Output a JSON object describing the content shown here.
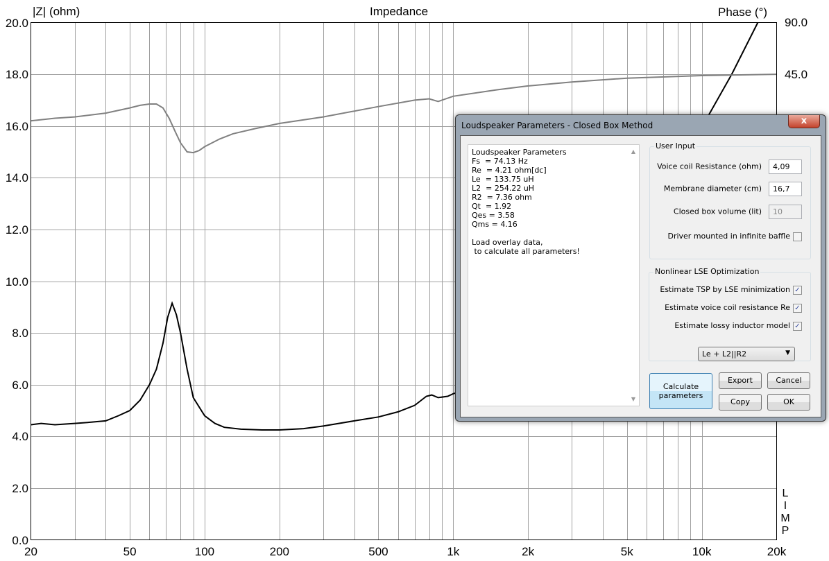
{
  "chart_data": {
    "type": "line",
    "title": "Impedance",
    "ylabel": "|Z| (ohm)",
    "y2label": "Phase (°)",
    "xscale": "log",
    "xlim": [
      20,
      20000
    ],
    "ylim": [
      0,
      20
    ],
    "y2ticks": [
      "90.0",
      "45.0"
    ],
    "xticks": [
      {
        "v": 20,
        "l": "20"
      },
      {
        "v": 50,
        "l": "50"
      },
      {
        "v": 100,
        "l": "100"
      },
      {
        "v": 200,
        "l": "200"
      },
      {
        "v": 500,
        "l": "500"
      },
      {
        "v": 1000,
        "l": "1k"
      },
      {
        "v": 2000,
        "l": "2k"
      },
      {
        "v": 5000,
        "l": "5k"
      },
      {
        "v": 10000,
        "l": "10k"
      },
      {
        "v": 20000,
        "l": "20k"
      }
    ],
    "yticks": [
      "0.0",
      "2.0",
      "4.0",
      "6.0",
      "8.0",
      "10.0",
      "12.0",
      "14.0",
      "16.0",
      "18.0",
      "20.0"
    ],
    "grid": true,
    "series": [
      {
        "name": "impedance",
        "color": "#000000",
        "x": [
          20,
          22,
          25,
          30,
          35,
          40,
          45,
          50,
          55,
          60,
          64,
          68,
          71,
          74,
          77,
          80,
          85,
          90,
          100,
          110,
          120,
          140,
          170,
          200,
          250,
          300,
          400,
          500,
          600,
          700,
          780,
          820,
          870,
          950,
          1000,
          2000,
          5000,
          8000,
          10700,
          13200,
          16800
        ],
        "y": [
          4.45,
          4.5,
          4.45,
          4.5,
          4.55,
          4.6,
          4.8,
          5.0,
          5.4,
          6.0,
          6.6,
          7.6,
          8.6,
          9.15,
          8.7,
          8.0,
          6.6,
          5.5,
          4.8,
          4.5,
          4.35,
          4.28,
          4.25,
          4.25,
          4.3,
          4.4,
          4.6,
          4.75,
          4.95,
          5.2,
          5.55,
          5.6,
          5.5,
          5.55,
          5.65,
          6.5,
          10,
          14,
          16.45,
          18,
          20
        ]
      },
      {
        "name": "phase",
        "color": "#808080",
        "x": [
          20,
          25,
          30,
          40,
          50,
          55,
          60,
          64,
          68,
          72,
          76,
          80,
          85,
          90,
          95,
          100,
          115,
          130,
          160,
          200,
          300,
          500,
          700,
          800,
          870,
          1000,
          1500,
          2000,
          3000,
          5000,
          10000,
          20000
        ],
        "y": [
          16.2,
          16.3,
          16.35,
          16.5,
          16.7,
          16.8,
          16.85,
          16.85,
          16.7,
          16.3,
          15.8,
          15.35,
          15.0,
          14.97,
          15.05,
          15.2,
          15.5,
          15.7,
          15.9,
          16.1,
          16.35,
          16.75,
          17.0,
          17.05,
          16.95,
          17.15,
          17.4,
          17.55,
          17.7,
          17.85,
          17.95,
          18.0
        ]
      }
    ]
  },
  "app": {
    "limp_label": [
      "L",
      "I",
      "M",
      "P"
    ]
  },
  "dialog": {
    "title": "Loudspeaker Parameters - Closed Box Method",
    "close": "x",
    "results": "Loudspeaker Parameters\nFs  = 74.13 Hz\nRe  = 4.21 ohm[dc]\nLe  = 133.75 uH\nL2  = 254.22 uH\nR2  = 7.36 ohm\nQt  = 1.92\nQes = 3.58\nQms = 4.16\n\nLoad overlay data,\n to calculate all parameters!",
    "user_input": {
      "caption": "User Input",
      "voice_coil_label": "Voice coil Resistance (ohm)",
      "voice_coil_value": "4,09",
      "membrane_label": "Membrane diameter (cm)",
      "membrane_value": "16,7",
      "volume_label": "Closed box volume (lit)",
      "volume_value": "10",
      "baffle_label": "Driver mounted in infinite baffle"
    },
    "lse": {
      "caption": "Nonlinear LSE Optimization",
      "tsp_label": "Estimate TSP by LSE minimization",
      "re_label": "Estimate voice coil resistance Re",
      "lossy_label": "Estimate lossy inductor model",
      "check": "✓",
      "model": "Le + L2||R2"
    },
    "buttons": {
      "calculate": "Calculate parameters",
      "export": "Export",
      "cancel": "Cancel",
      "copy": "Copy",
      "ok": "OK"
    }
  }
}
